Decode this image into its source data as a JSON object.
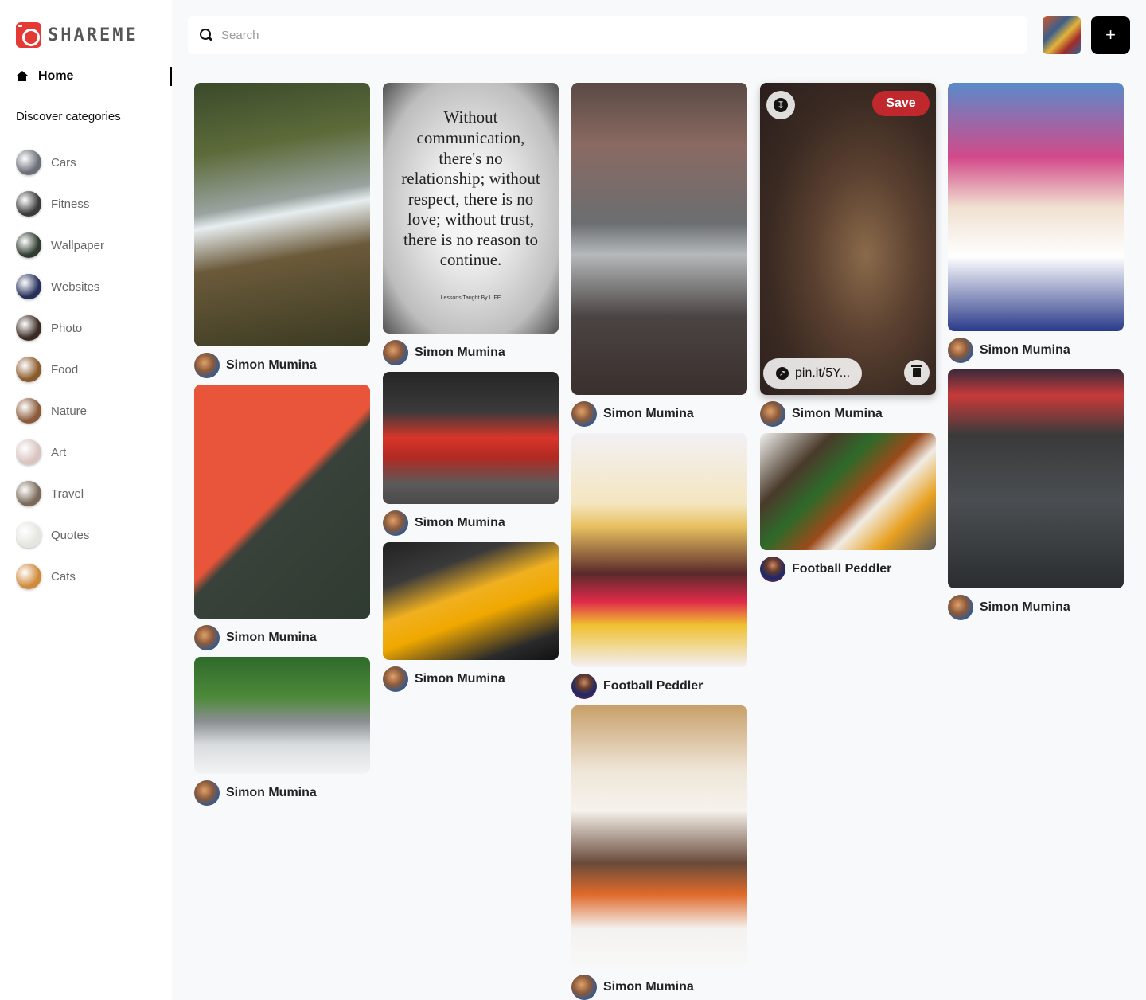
{
  "brand": {
    "name": "SHAREME"
  },
  "sidebar": {
    "home_label": "Home",
    "discover_label": "Discover categories",
    "categories": [
      {
        "label": "Cars",
        "color": "#6b6f78"
      },
      {
        "label": "Fitness",
        "color": "#3a3a3a"
      },
      {
        "label": "Wallpaper",
        "color": "#2f3b2f"
      },
      {
        "label": "Websites",
        "color": "#27305a"
      },
      {
        "label": "Photo",
        "color": "#3a2a22"
      },
      {
        "label": "Food",
        "color": "#8a5a2a"
      },
      {
        "label": "Nature",
        "color": "#8a5a3a"
      },
      {
        "label": "Art",
        "color": "#d9c4c0"
      },
      {
        "label": "Travel",
        "color": "#7a6a5a"
      },
      {
        "label": "Quotes",
        "color": "#e6e6e0"
      },
      {
        "label": "Cats",
        "color": "#d08a3a"
      },
      {
        "label": "",
        "color": "#b89a6a"
      }
    ]
  },
  "header": {
    "search_placeholder": "Search",
    "add_label": "+"
  },
  "pins": [
    {
      "author": "Simon Mumina",
      "avatar": "simon",
      "gradient": "linear-gradient(170deg,#3a4a2a 0%,#5d6b3a 25%,#9aa3a0 45%,#e7eef0 50%,#6b5a3a 65%,#3a3a22 100%)"
    },
    {
      "author": "Simon Mumina",
      "avatar": "simon",
      "gradient": "linear-gradient(135deg,#e8553a 0%,#e8553a 48%,#39423a 52%,#2f3a30 100%)"
    },
    {
      "author": "Simon Mumina",
      "avatar": "simon",
      "gradient": "linear-gradient(180deg,#2e6a2a 0%,#4e8a3a 35%,#8a8e92 55%,#d9dcdd 75%,#f2f4f4 100%)"
    },
    {
      "quote": "Without communication, there's no relationship; without respect, there is no love; without trust, there is no reason to continue.",
      "quote_sig": "Lessons Taught By LIFE",
      "author": "Simon Mumina",
      "avatar": "simon"
    },
    {
      "author": "Simon Mumina",
      "avatar": "simon",
      "gradient": "linear-gradient(180deg,#262626 0%,#3a3a3a 30%,#d8352a 50%,#b02a22 65%,#5a5a5a 85%,#4a4a4a 100%)"
    },
    {
      "author": "Simon Mumina",
      "avatar": "simon",
      "gradient": "linear-gradient(160deg,#222 0%,#3a3a3a 25%,#f0b020 45%,#f0a800 60%,#2a2a2a 85%,#111 100%)"
    },
    {
      "author": "Simon Mumina",
      "avatar": "simon",
      "gradient": "linear-gradient(180deg,#5a4a44 0%,#8a6a62 20%,#6b6e70 45%,#b6b9bb 55%,#4a4442 75%,#3a302e 100%)"
    },
    {
      "author": "Football Peddler",
      "avatar": "football",
      "gradient": "linear-gradient(180deg,#f2f0f4 0%,#f4e6c0 30%,#e8c060 40%,#5a2a2a 60%,#e02a4a 72%,#f0c030 82%,#f2f0f4 100%)"
    },
    {
      "author": "Simon Mumina",
      "avatar": "simon",
      "gradient": "linear-gradient(180deg,#c8a06a 0%,#efe6d8 25%,#f6f2ec 40%,#6a4a3a 60%,#e06a2a 72%,#f4f2f0 85%,#f8f8f8 100%)"
    },
    {
      "author": "Simon Mumina",
      "avatar": "simon",
      "gradient": "radial-gradient(ellipse at 60% 55%,#8a6a4a 0%,#5a4030 35%,#3a2a22 65%,#2a1e1c 100%)",
      "hover": true,
      "save_label": "Save",
      "link_label": "pin.it/5Y..."
    },
    {
      "author": "Football Peddler",
      "avatar": "football",
      "gradient": "linear-gradient(135deg,#f0f0ee 0%,#4a3a2a 25%,#2e6a2a 40%,#9a4a1a 55%,#f0ece4 65%,#e8a020 80%,#5a5a5a 100%)"
    },
    {
      "author": "Simon Mumina",
      "avatar": "simon",
      "gradient": "linear-gradient(180deg,#5a8aca 0%,#d24a8a 30%,#f0e0d0 50%,#ffffff 70%,#2a3a8a 100%)"
    },
    {
      "author": "Simon Mumina",
      "avatar": "simon",
      "gradient": "linear-gradient(180deg,#3a2a3a 0%,#c83a3a 12%,#3a3a3a 30%,#4a4e52 60%,#2a2e30 100%)"
    }
  ]
}
